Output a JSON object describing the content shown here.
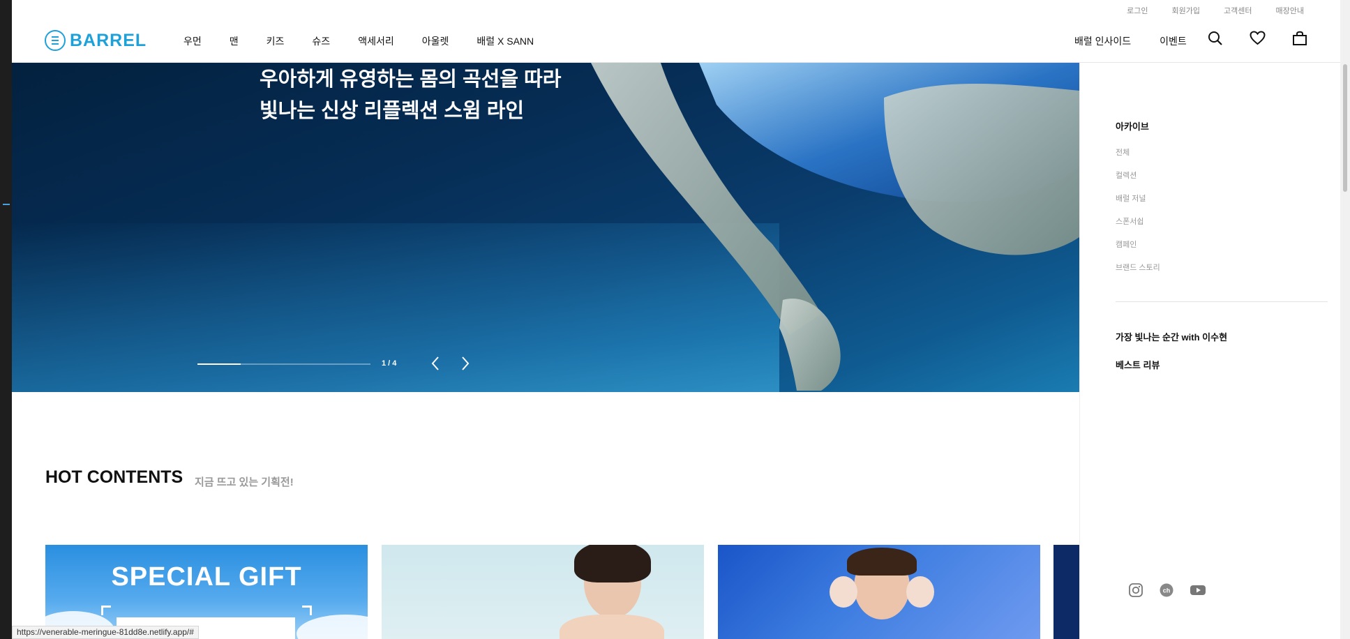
{
  "header": {
    "util_links": [
      "로그인",
      "회원가입",
      "고객센터",
      "매장안내"
    ],
    "logo_text": "BARREL",
    "gnb": [
      "우먼",
      "맨",
      "키즈",
      "슈즈",
      "액세서리",
      "아울렛",
      "배럴 X SANN"
    ],
    "right_links": [
      "배럴 인사이드",
      "이벤트"
    ],
    "icons": [
      "search-icon",
      "heart-icon",
      "bag-icon"
    ]
  },
  "hero": {
    "title_line1": "우아하게 유영하는 몸의 곡선을 따라",
    "title_line2": "빛나는 신상 리플렉션 스윔 라인",
    "pager": "1 / 4",
    "progress": 0.25
  },
  "side_panel": {
    "archive_title": "아카이브",
    "archive_items": [
      "전체",
      "컬렉션",
      "배럴 저널",
      "스폰서쉽",
      "캠페인",
      "브랜드 스토리"
    ],
    "feature_links": [
      "가장 빛나는 순간 with 이수현",
      "베스트 리뷰"
    ],
    "sns": [
      "instagram-icon",
      "kakao-channel-icon",
      "youtube-icon"
    ]
  },
  "hot": {
    "title": "HOT CONTENTS",
    "subtitle": "지금 뜨고 있는 기획전!",
    "card1_text": "SPECIAL GIFT"
  },
  "status_url": "https://venerable-meringue-81dd8e.netlify.app/#",
  "colors": {
    "brand": "#1ea1d9",
    "text": "#111111",
    "muted": "#999999"
  }
}
